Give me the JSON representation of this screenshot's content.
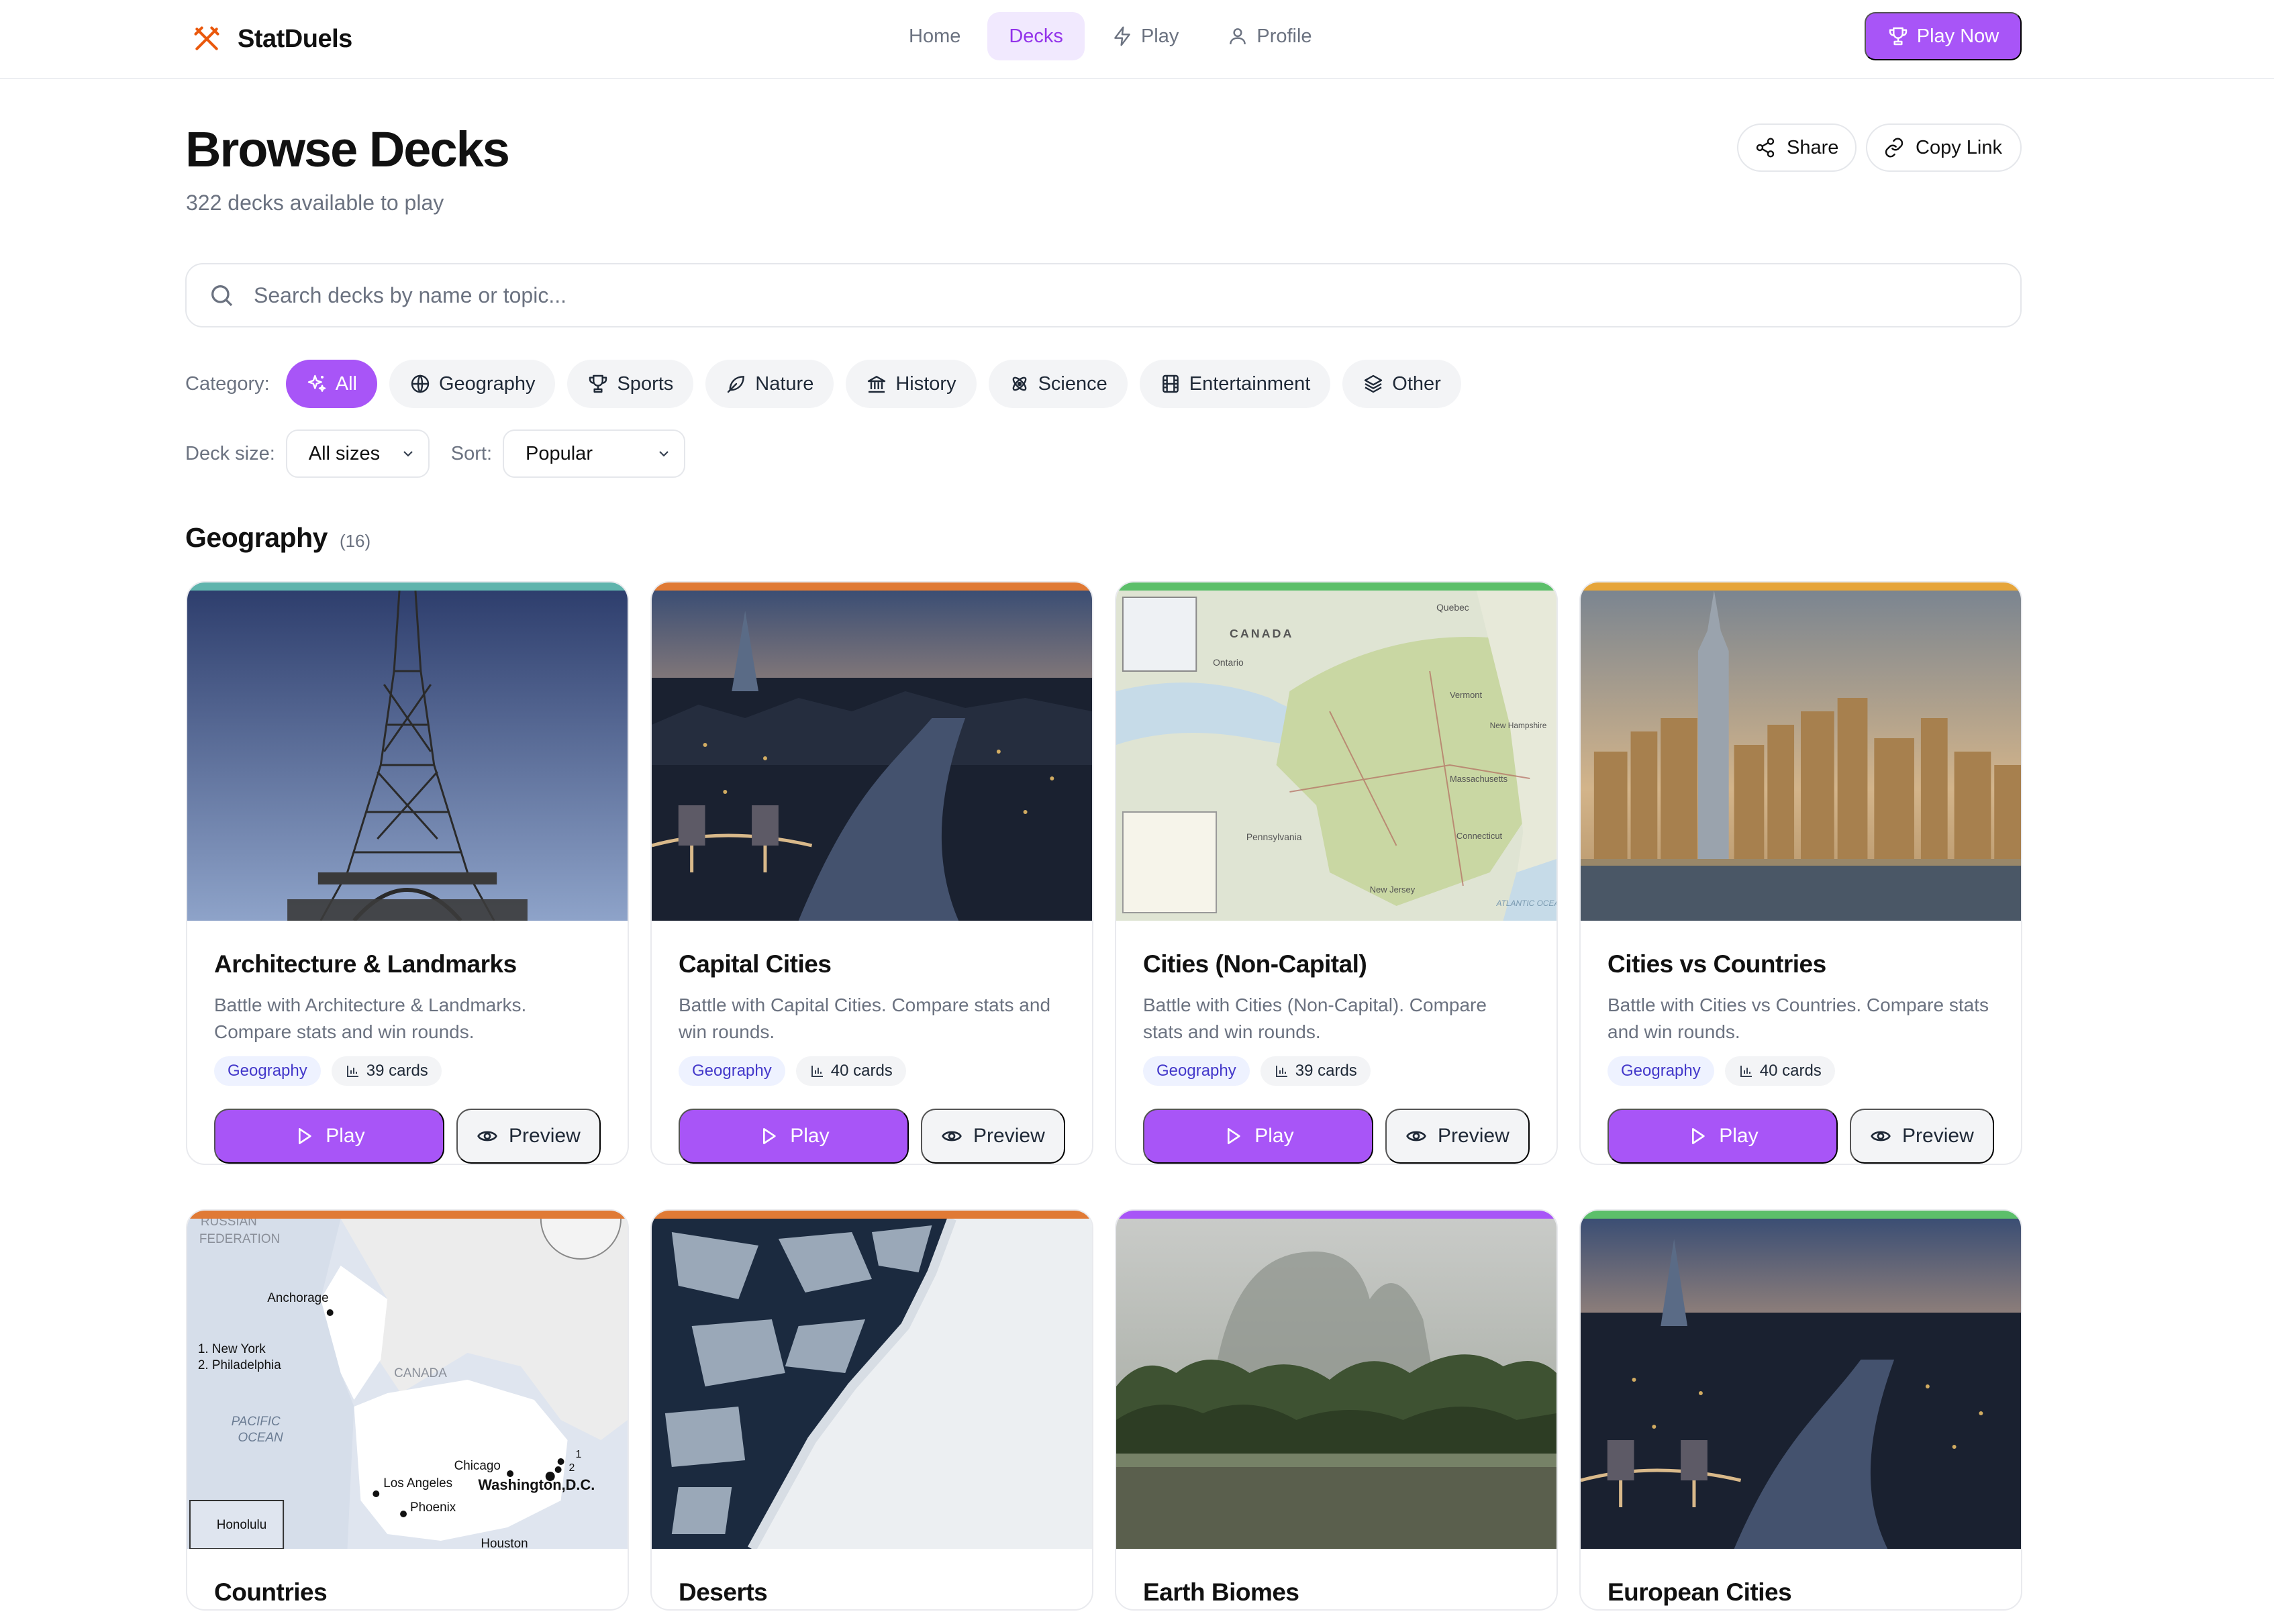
{
  "nav": {
    "brand": "StatDuels",
    "links": [
      {
        "label": "Home",
        "icon": "none"
      },
      {
        "label": "Decks",
        "icon": "none",
        "active": true
      },
      {
        "label": "Play",
        "icon": "lightning-icon"
      },
      {
        "label": "Profile",
        "icon": "user-icon"
      }
    ],
    "cta": "Play Now"
  },
  "header": {
    "title": "Browse Decks",
    "subtitle": "322 decks available to play",
    "share": "Share",
    "copy_link": "Copy Link"
  },
  "search": {
    "placeholder": "Search decks by name or topic..."
  },
  "category": {
    "label": "Category:",
    "chips": [
      "All",
      "Geography",
      "Sports",
      "Nature",
      "History",
      "Science",
      "Entertainment",
      "Other"
    ],
    "active": "All"
  },
  "filters": {
    "size_label": "Deck size:",
    "size_value": "All sizes",
    "sort_label": "Sort:",
    "sort_value": "Popular"
  },
  "section": {
    "title": "Geography",
    "count": "(16)"
  },
  "cards": [
    {
      "name": "Architecture & Landmarks",
      "desc": "Battle with Architecture & Landmarks. Compare stats and win rounds.",
      "category": "Geography",
      "count": "39 cards",
      "accent": "#5fb4ad"
    },
    {
      "name": "Capital Cities",
      "desc": "Battle with Capital Cities. Compare stats and win rounds.",
      "category": "Geography",
      "count": "40 cards",
      "accent": "#e07a35"
    },
    {
      "name": "Cities (Non-Capital)",
      "desc": "Battle with Cities (Non-Capital). Compare stats and win rounds.",
      "category": "Geography",
      "count": "39 cards",
      "accent": "#5cbf6a"
    },
    {
      "name": "Cities vs Countries",
      "desc": "Battle with Cities vs Countries. Compare stats and win rounds.",
      "category": "Geography",
      "count": "40 cards",
      "accent": "#e6a53a"
    },
    {
      "name": "Countries",
      "accent": "#e07a35"
    },
    {
      "name": "Deserts",
      "accent": "#e07a35"
    },
    {
      "name": "Earth Biomes",
      "accent": "#a855f7"
    },
    {
      "name": "European Cities",
      "accent": "#5cbf6a"
    }
  ],
  "buttons": {
    "play": "Play",
    "preview": "Preview"
  },
  "map_labels": {
    "countries": [
      "RUSSIAN",
      "FEDERATION",
      "Anchorage",
      "1. New York",
      "2. Philadelphia",
      "CANADA",
      "PACIFIC",
      "OCEAN",
      "Chicago",
      "Los Angeles",
      "Washington,D.C.",
      "Phoenix",
      "Honolulu",
      "Houston",
      "1",
      "2"
    ],
    "newyork": [
      "CANADA",
      "Ontario",
      "Quebec",
      "Vermont",
      "New Hampshire",
      "Massachusetts",
      "Connecticut",
      "Pennsylvania",
      "New Jersey",
      "ATLANTIC OCEAN"
    ]
  }
}
